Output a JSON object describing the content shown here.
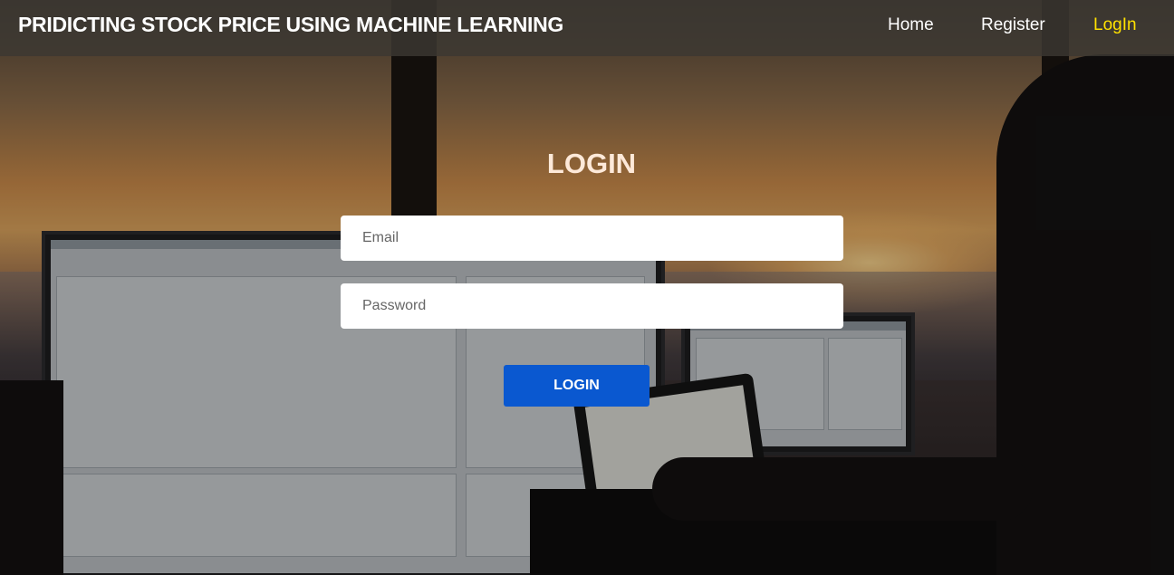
{
  "nav": {
    "brand": "PRIDICTING STOCK PRICE USING MACHINE LEARNING",
    "links": [
      {
        "label": "Home",
        "active": false
      },
      {
        "label": "Register",
        "active": false
      },
      {
        "label": "LogIn",
        "active": true
      }
    ]
  },
  "login": {
    "title": "LOGIN",
    "email_placeholder": "Email",
    "password_placeholder": "Password",
    "submit_label": "LOGIN"
  },
  "colors": {
    "nav_bg": "#3c3832",
    "active_link": "#ffe100",
    "button": "#0a58d0",
    "title": "#fde9d9"
  }
}
